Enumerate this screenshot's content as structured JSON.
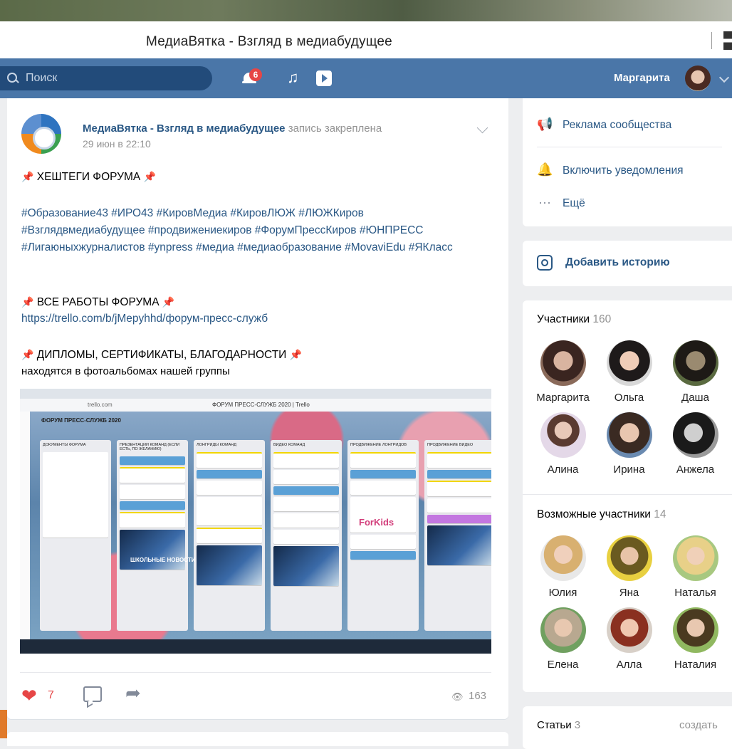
{
  "browser": {
    "title": "МедиаВятка - Взгляд в медиабудущее"
  },
  "header": {
    "search_placeholder": "Поиск",
    "notifications_count": "6",
    "user_name": "Маргарита"
  },
  "post": {
    "author": "МедиаВятка - Взгляд в медиабудущее",
    "pinned_note": "запись закреплена",
    "date": "29 июн в 22:10",
    "heading1": "ХЕШТЕГИ ФОРУМА",
    "hashtags": "#Образование43 #ИРО43 #КировМедиа #КировЛЮЖ #ЛЮЖКиров #Взглядвмедиабудущее #продвижениекиров #ФорумПрессКиров #ЮНПРЕСС #Лигаюныхжурналистов #ynpress #медиа #медиаобразование #MovaviEdu #ЯКласс",
    "heading2": "ВСЕ РАБОТЫ ФОРУМА",
    "link": "https://trello.com/b/jMepyhhd/форум-пресс-служб",
    "heading3": "ДИПЛОМЫ, СЕРТИФИКАТЫ, БЛАГОДАРНОСТИ",
    "subtext": "находятся в фотоальбомах нашей группы",
    "likes": "7",
    "views": "163",
    "screenshot": {
      "url": "trello.com",
      "tab_title": "ФОРУМ ПРЕСС-СЛУЖБ 2020 | Trello",
      "board_title": "ФОРУМ ПРЕСС-СЛУЖБ 2020",
      "lists": [
        "ДОКУМЕНТЫ ФОРУМА",
        "ПРЕЗЕНТАЦИИ КОМАНД (ЕСЛИ ЕСТЬ, ПО ЖЕЛАНИЮ)",
        "ЛОНГРИДЫ КОМАНД",
        "ВИДЕО КОМАНД",
        "ПРОДВИЖЕНИЕ ЛОНГРИДОВ",
        "ПРОДВИЖЕНИЕ ВИДЕО"
      ],
      "forkids": "ForKids",
      "school_news": "ШКОЛЬНЫЕ НОВОСТИ"
    }
  },
  "sidebar": {
    "actions": [
      {
        "icon": "megaphone-icon",
        "label": "Реклама сообщества"
      },
      {
        "icon": "bell-icon",
        "label": "Включить уведомления"
      },
      {
        "icon": "more-icon",
        "label": "Ещё"
      }
    ],
    "add_story": "Добавить историю",
    "members_title": "Участники",
    "members_count": "160",
    "members": [
      "Маргарита",
      "Ольга",
      "Даша",
      "Алина",
      "Ирина",
      "Анжела"
    ],
    "possible_title": "Возможные участники",
    "possible_count": "14",
    "possible": [
      "Юлия",
      "Яна",
      "Наталья",
      "Елена",
      "Алла",
      "Наталия"
    ],
    "articles_title": "Статьи",
    "articles_count": "3",
    "articles_create": "создать"
  },
  "colors": {
    "vk_blue": "#4a76a8",
    "link": "#2a5885",
    "like_red": "#e64646"
  }
}
